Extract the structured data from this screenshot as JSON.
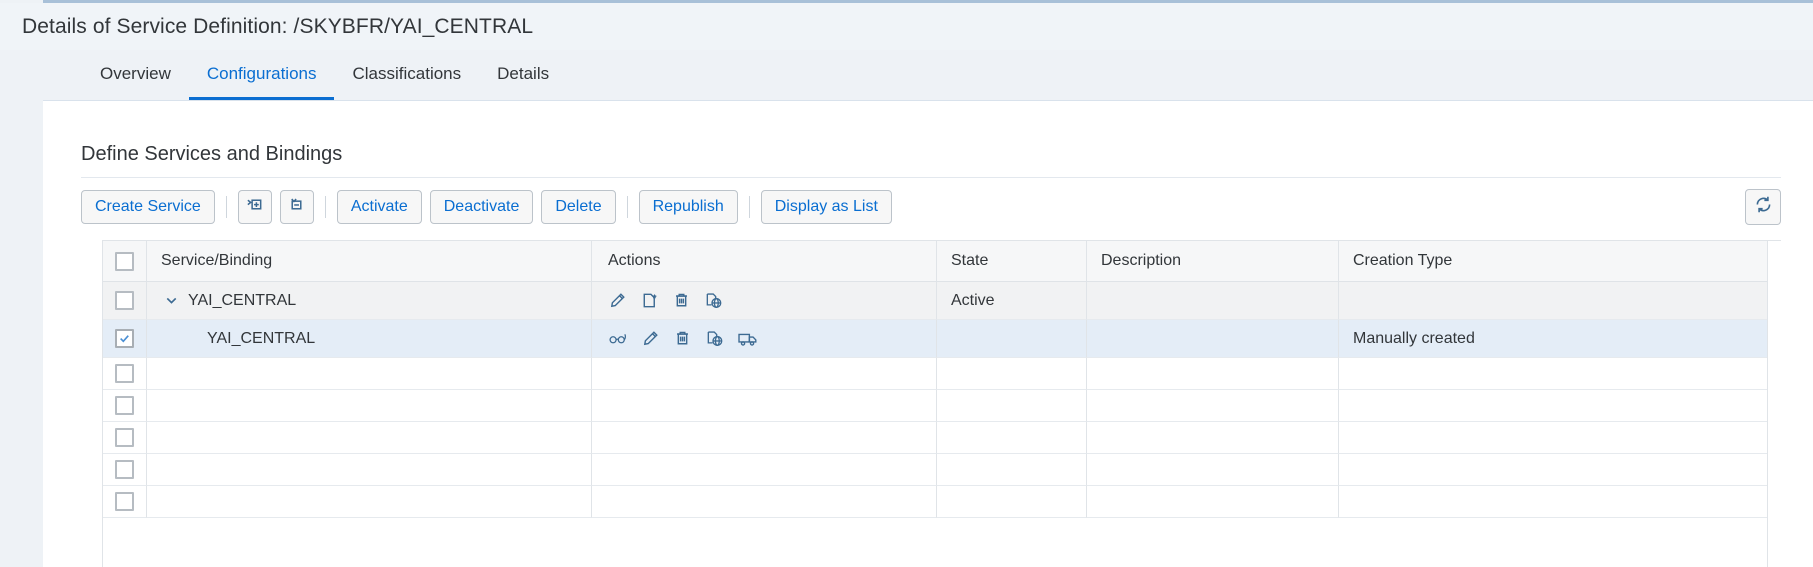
{
  "header": {
    "title": "Details of Service Definition: /SKYBFR/YAI_CENTRAL"
  },
  "tabs": [
    {
      "label": "Overview",
      "active": false
    },
    {
      "label": "Configurations",
      "active": true
    },
    {
      "label": "Classifications",
      "active": false
    },
    {
      "label": "Details",
      "active": false
    }
  ],
  "section": {
    "title": "Define Services and Bindings"
  },
  "toolbar": {
    "create_service_label": "Create Service",
    "expand_all_icon": "expand-all-icon",
    "collapse_all_icon": "collapse-all-icon",
    "activate_label": "Activate",
    "deactivate_label": "Deactivate",
    "delete_label": "Delete",
    "republish_label": "Republish",
    "display_as_list_label": "Display as List",
    "refresh_icon": "refresh-icon"
  },
  "table": {
    "columns": [
      "Service/Binding",
      "Actions",
      "State",
      "Description",
      "Creation Type"
    ],
    "rows": [
      {
        "selected": false,
        "expanded": true,
        "level": 0,
        "name": "YAI_CENTRAL",
        "state": "Active",
        "description": "",
        "creation_type": "",
        "actions": [
          "edit-icon",
          "create-document-icon",
          "delete-icon",
          "publish-globe-icon"
        ]
      },
      {
        "selected": true,
        "expanded": false,
        "level": 1,
        "name": "YAI_CENTRAL",
        "state": "",
        "description": "",
        "creation_type": "Manually created",
        "actions": [
          "display-glasses-icon",
          "edit-icon",
          "delete-icon",
          "publish-globe-icon",
          "transport-truck-icon"
        ]
      }
    ],
    "empty_row_count": 5
  },
  "colors": {
    "accent": "#0a6ed1",
    "icon": "#3c6a92",
    "page_background": "#eef2f6",
    "selected_row": "#e4edf7"
  }
}
